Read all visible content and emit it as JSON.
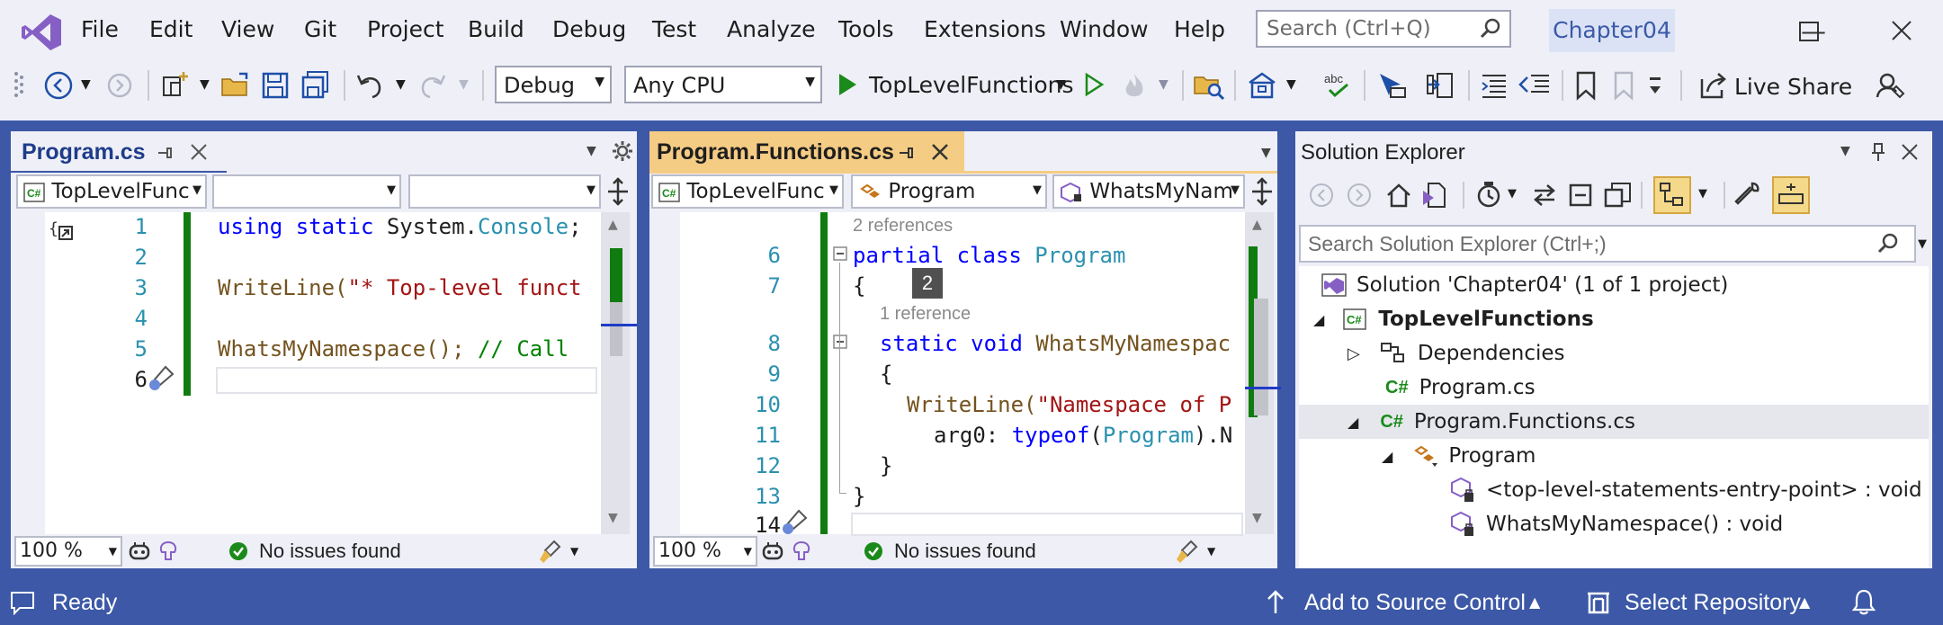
{
  "menu": {
    "items": [
      "File",
      "Edit",
      "View",
      "Git",
      "Project",
      "Build",
      "Debug",
      "Test",
      "Analyze",
      "Tools",
      "Extensions",
      "Window",
      "Help"
    ],
    "search_placeholder": "Search (Ctrl+Q)",
    "project_title": "Chapter04"
  },
  "toolbar": {
    "config": "Debug",
    "platform": "Any CPU",
    "startup": "TopLevelFunctions",
    "live_share": "Live Share"
  },
  "editor1": {
    "tab": "Program.cs",
    "nav1": "TopLevelFunc",
    "nav2": "",
    "nav3": "",
    "lines": [
      "1",
      "2",
      "3",
      "4",
      "5",
      "6"
    ],
    "code": {
      "l1_kw": "using static",
      "l1_ns": " System.",
      "l1_ty": "Console",
      "l1_end": ";",
      "l3_fn": "WriteLine(",
      "l3_str": "\"* Top-level funct",
      "l5_fn": "WhatsMyNamespace(); ",
      "l5_cm": "// Call"
    },
    "zoom": "100 %",
    "status": "No issues found"
  },
  "editor2": {
    "tab": "Program.Functions.cs",
    "nav1": "TopLevelFunc",
    "nav2": "Program",
    "nav3": "WhatsMyNam",
    "codelens1": "2 references",
    "codelens2": "1 reference",
    "hint": "2",
    "lines": [
      "6",
      "7",
      "8",
      "9",
      "10",
      "11",
      "12",
      "13",
      "14"
    ],
    "code": {
      "l6_kw": "partial class ",
      "l6_ty": "Program",
      "l7": "{",
      "l8_kw": "static void ",
      "l8_fn": "WhatsMyNamespac",
      "l9": "{",
      "l10_fn": "WriteLine(",
      "l10_str": "\"Namespace of P",
      "l11_arg": "arg0: ",
      "l11_kw": "typeof",
      "l11_p": "(",
      "l11_ty": "Program",
      "l11_end": ").N",
      "l12": "}",
      "l13": "}"
    },
    "zoom": "100 %",
    "status": "No issues found"
  },
  "solution_explorer": {
    "title": "Solution Explorer",
    "search_placeholder": "Search Solution Explorer (Ctrl+;)",
    "items": [
      {
        "label": "Solution 'Chapter04' (1 of 1 project)"
      },
      {
        "label": "TopLevelFunctions"
      },
      {
        "label": "Dependencies"
      },
      {
        "label": "Program.cs"
      },
      {
        "label": "Program.Functions.cs"
      },
      {
        "label": "Program"
      },
      {
        "label": "<top-level-statements-entry-point> : void"
      },
      {
        "label": "WhatsMyNamespace() : void"
      }
    ]
  },
  "statusbar": {
    "ready": "Ready",
    "source_control": "Add to Source Control",
    "repository": "Select Repository"
  },
  "colors": {
    "accent": "#3c58a6",
    "active_tab": "#f5cc84",
    "code_green": "#107c10"
  }
}
